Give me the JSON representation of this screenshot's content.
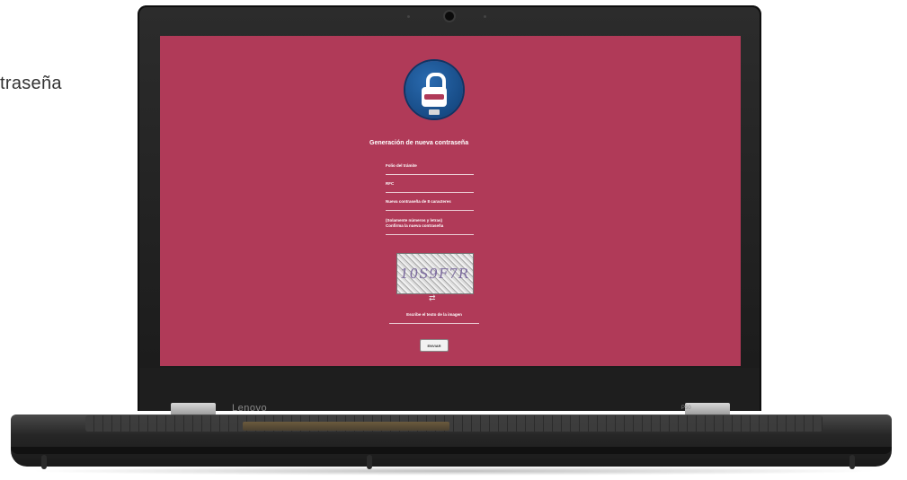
{
  "caption": {
    "text": "traseña"
  },
  "laptop": {
    "brand": "Lenovo",
    "model": "P50"
  },
  "form": {
    "title": "Generación de nueva contraseña",
    "folio_label": "Folio del trámite",
    "rfc_label": "RFC",
    "new_password_label": "Nueva contraseña de 8 caracteres",
    "new_password_hint": "(Solamente números y letras)",
    "confirm_label": "Confirma la nueva contraseña",
    "captcha_text": "10S9F7R",
    "captcha_instruction": "Escribe el texto de la imagen",
    "submit_label": "ENVIAR"
  },
  "colors": {
    "screen_bg": "#b03a58",
    "logo_blue": "#1a4f8f"
  },
  "icons": [
    "lock-icon",
    "refresh-icon"
  ]
}
